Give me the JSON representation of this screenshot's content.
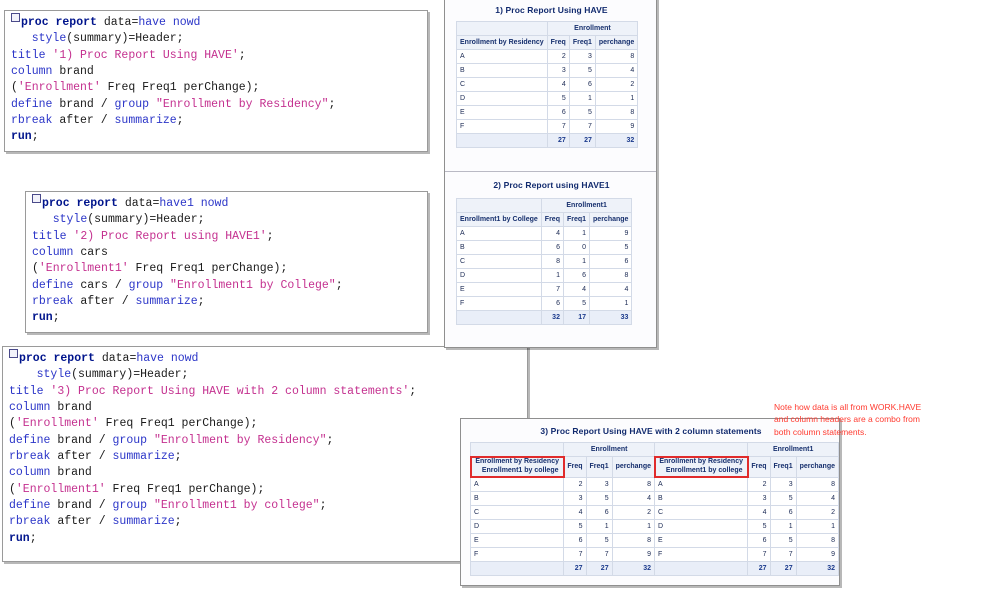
{
  "code_blocks": [
    {
      "name": "proc-report-have",
      "lines": [
        [
          {
            "t": "box",
            "v": ""
          },
          {
            "t": "kw",
            "v": "proc report "
          },
          {
            "t": "plain",
            "v": "data"
          },
          {
            "t": "plain",
            "v": "="
          },
          {
            "t": "stmt",
            "v": "have nowd"
          }
        ],
        [
          {
            "t": "plain",
            "v": "   "
          },
          {
            "t": "stmt",
            "v": "style"
          },
          {
            "t": "plain",
            "v": "(summary)=Header;"
          }
        ],
        [
          {
            "t": "stmt",
            "v": "title "
          },
          {
            "t": "str",
            "v": "'1) Proc Report Using HAVE'"
          },
          {
            "t": "plain",
            "v": ";"
          }
        ],
        [
          {
            "t": "stmt",
            "v": "column "
          },
          {
            "t": "plain",
            "v": "brand"
          }
        ],
        [
          {
            "t": "plain",
            "v": "("
          },
          {
            "t": "str",
            "v": "'Enrollment'"
          },
          {
            "t": "plain",
            "v": " Freq Freq1 perChange);"
          }
        ],
        [
          {
            "t": "stmt",
            "v": "define "
          },
          {
            "t": "plain",
            "v": "brand / "
          },
          {
            "t": "stmt",
            "v": "group "
          },
          {
            "t": "str",
            "v": "\"Enrollment by Residency\""
          },
          {
            "t": "plain",
            "v": ";"
          }
        ],
        [
          {
            "t": "stmt",
            "v": "rbreak "
          },
          {
            "t": "plain",
            "v": "after / "
          },
          {
            "t": "stmt",
            "v": "summarize"
          },
          {
            "t": "plain",
            "v": ";"
          }
        ],
        [
          {
            "t": "kw",
            "v": "run"
          },
          {
            "t": "plain",
            "v": ";"
          }
        ]
      ]
    },
    {
      "name": "proc-report-have1",
      "lines": [
        [
          {
            "t": "box",
            "v": ""
          },
          {
            "t": "kw",
            "v": "proc report "
          },
          {
            "t": "plain",
            "v": "data"
          },
          {
            "t": "plain",
            "v": "="
          },
          {
            "t": "stmt",
            "v": "have1 nowd"
          }
        ],
        [
          {
            "t": "plain",
            "v": "   "
          },
          {
            "t": "stmt",
            "v": "style"
          },
          {
            "t": "plain",
            "v": "(summary)=Header;"
          }
        ],
        [
          {
            "t": "stmt",
            "v": "title "
          },
          {
            "t": "str",
            "v": "'2) Proc Report using HAVE1'"
          },
          {
            "t": "plain",
            "v": ";"
          }
        ],
        [
          {
            "t": "stmt",
            "v": "column "
          },
          {
            "t": "plain",
            "v": "cars"
          }
        ],
        [
          {
            "t": "plain",
            "v": "("
          },
          {
            "t": "str",
            "v": "'Enrollment1'"
          },
          {
            "t": "plain",
            "v": " Freq Freq1 perChange);"
          }
        ],
        [
          {
            "t": "stmt",
            "v": "define "
          },
          {
            "t": "plain",
            "v": "cars / "
          },
          {
            "t": "stmt",
            "v": "group "
          },
          {
            "t": "str",
            "v": "\"Enrollment1 by College\""
          },
          {
            "t": "plain",
            "v": ";"
          }
        ],
        [
          {
            "t": "stmt",
            "v": "rbreak "
          },
          {
            "t": "plain",
            "v": "after / "
          },
          {
            "t": "stmt",
            "v": "summarize"
          },
          {
            "t": "plain",
            "v": ";"
          }
        ],
        [
          {
            "t": "kw",
            "v": "run"
          },
          {
            "t": "plain",
            "v": ";"
          }
        ]
      ]
    },
    {
      "name": "proc-report-have-2col",
      "lines": [
        [
          {
            "t": "box",
            "v": ""
          },
          {
            "t": "kw",
            "v": "proc report "
          },
          {
            "t": "plain",
            "v": "data"
          },
          {
            "t": "plain",
            "v": "="
          },
          {
            "t": "stmt",
            "v": "have nowd"
          }
        ],
        [
          {
            "t": "plain",
            "v": "    "
          },
          {
            "t": "stmt",
            "v": "style"
          },
          {
            "t": "plain",
            "v": "(summary)=Header;"
          }
        ],
        [
          {
            "t": "stmt",
            "v": "title "
          },
          {
            "t": "str",
            "v": "'3) Proc Report Using HAVE with 2 column statements'"
          },
          {
            "t": "plain",
            "v": ";"
          }
        ],
        [
          {
            "t": "stmt",
            "v": "column "
          },
          {
            "t": "plain",
            "v": "brand"
          }
        ],
        [
          {
            "t": "plain",
            "v": "("
          },
          {
            "t": "str",
            "v": "'Enrollment'"
          },
          {
            "t": "plain",
            "v": " Freq Freq1 perChange);"
          }
        ],
        [
          {
            "t": "stmt",
            "v": "define "
          },
          {
            "t": "plain",
            "v": "brand / "
          },
          {
            "t": "stmt",
            "v": "group "
          },
          {
            "t": "str",
            "v": "\"Enrollment by Residency\""
          },
          {
            "t": "plain",
            "v": ";"
          }
        ],
        [
          {
            "t": "stmt",
            "v": "rbreak "
          },
          {
            "t": "plain",
            "v": "after / "
          },
          {
            "t": "stmt",
            "v": "summarize"
          },
          {
            "t": "plain",
            "v": ";"
          }
        ],
        [
          {
            "t": "stmt",
            "v": "column "
          },
          {
            "t": "plain",
            "v": "brand"
          }
        ],
        [
          {
            "t": "plain",
            "v": "("
          },
          {
            "t": "str",
            "v": "'Enrollment1'"
          },
          {
            "t": "plain",
            "v": " Freq Freq1 perChange);"
          }
        ],
        [
          {
            "t": "stmt",
            "v": "define "
          },
          {
            "t": "plain",
            "v": "brand / "
          },
          {
            "t": "stmt",
            "v": "group "
          },
          {
            "t": "str",
            "v": "\"Enrollment1 by college\""
          },
          {
            "t": "plain",
            "v": ";"
          }
        ],
        [
          {
            "t": "stmt",
            "v": "rbreak "
          },
          {
            "t": "plain",
            "v": "after / "
          },
          {
            "t": "stmt",
            "v": "summarize"
          },
          {
            "t": "plain",
            "v": ";"
          }
        ],
        [
          {
            "t": "kw",
            "v": "run"
          },
          {
            "t": "plain",
            "v": ";"
          }
        ]
      ]
    }
  ],
  "report1": {
    "title": "1) Proc Report Using HAVE",
    "spanner": "Enrollment",
    "row_header": "Enrollment by Residency",
    "columns": [
      "Freq",
      "Freq1",
      "perchange"
    ],
    "rows": [
      {
        "label": "A",
        "values": [
          "2",
          "3",
          "8"
        ]
      },
      {
        "label": "B",
        "values": [
          "3",
          "5",
          "4"
        ]
      },
      {
        "label": "C",
        "values": [
          "4",
          "6",
          "2"
        ]
      },
      {
        "label": "D",
        "values": [
          "5",
          "1",
          "1"
        ]
      },
      {
        "label": "E",
        "values": [
          "6",
          "5",
          "8"
        ]
      },
      {
        "label": "F",
        "values": [
          "7",
          "7",
          "9"
        ]
      }
    ],
    "summary": {
      "label": "",
      "values": [
        "27",
        "27",
        "32"
      ]
    }
  },
  "report2": {
    "title": "2) Proc Report using HAVE1",
    "spanner": "Enrollment1",
    "row_header": "Enrollment1 by College",
    "columns": [
      "Freq",
      "Freq1",
      "perchange"
    ],
    "rows": [
      {
        "label": "A",
        "values": [
          "4",
          "1",
          "9"
        ]
      },
      {
        "label": "B",
        "values": [
          "6",
          "0",
          "5"
        ]
      },
      {
        "label": "C",
        "values": [
          "8",
          "1",
          "6"
        ]
      },
      {
        "label": "D",
        "values": [
          "1",
          "6",
          "8"
        ]
      },
      {
        "label": "E",
        "values": [
          "7",
          "4",
          "4"
        ]
      },
      {
        "label": "F",
        "values": [
          "6",
          "5",
          "1"
        ]
      }
    ],
    "summary": {
      "label": "",
      "values": [
        "32",
        "17",
        "33"
      ]
    }
  },
  "report3": {
    "title": "3) Proc Report Using HAVE with 2 column statements",
    "spanner_left": "Enrollment",
    "spanner_right": "Enrollment1",
    "row_header_line1": "Enrollment by Residency",
    "row_header_line2": "Enrollment1 by college",
    "columns": [
      "Freq",
      "Freq1",
      "perchange"
    ],
    "rows": [
      {
        "label": "A",
        "left": [
          "2",
          "3",
          "8"
        ],
        "right": [
          "2",
          "3",
          "8"
        ]
      },
      {
        "label": "B",
        "left": [
          "3",
          "5",
          "4"
        ],
        "right": [
          "3",
          "5",
          "4"
        ]
      },
      {
        "label": "C",
        "left": [
          "4",
          "6",
          "2"
        ],
        "right": [
          "4",
          "6",
          "2"
        ]
      },
      {
        "label": "D",
        "left": [
          "5",
          "1",
          "1"
        ],
        "right": [
          "5",
          "1",
          "1"
        ]
      },
      {
        "label": "E",
        "left": [
          "6",
          "5",
          "8"
        ],
        "right": [
          "6",
          "5",
          "8"
        ]
      },
      {
        "label": "F",
        "left": [
          "7",
          "7",
          "9"
        ],
        "right": [
          "7",
          "7",
          "9"
        ]
      }
    ],
    "summary": {
      "left": [
        "27",
        "27",
        "32"
      ],
      "right": [
        "27",
        "27",
        "32"
      ]
    }
  },
  "annotation": {
    "text": "Note how data is all from WORK.HAVE\nand column headers are a combo from\nboth column statements.",
    "color": "#ff3b30"
  }
}
